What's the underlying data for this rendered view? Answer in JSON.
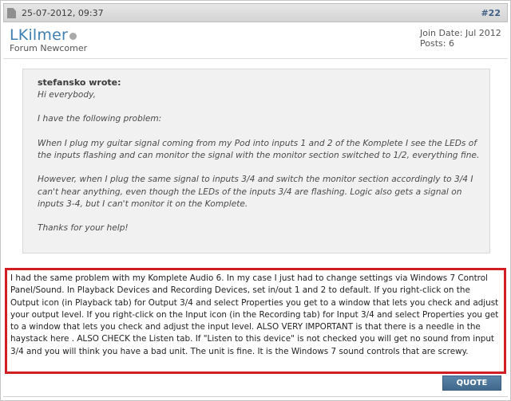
{
  "post": {
    "date": "25-07-2012, 09:37",
    "number": "#22"
  },
  "user": {
    "name": "LKilmer",
    "title": "Forum Newcomer",
    "join_date": "Join Date: Jul 2012",
    "posts": "Posts: 6",
    "status_color": "#a9a9a9"
  },
  "quote": {
    "author": "stefansko wrote:",
    "paragraphs": [
      "Hi everybody,",
      "I have the following problem:",
      "When I plug my guitar signal coming from my Pod into inputs 1 and 2 of the Komplete I see the LEDs of the inputs flashing and can monitor the signal with the monitor section switched to 1/2, everything fine.",
      "However, when I plug the same signal to inputs 3/4 and switch the monitor section accordingly to 3/4 I can't hear anything, even though the LEDs of the inputs 3/4 are flashing. Logic also gets a signal on inputs 3-4, but I can't monitor it on the Komplete.",
      "Thanks for your help!"
    ]
  },
  "reply": {
    "text": "I had the same problem with my Komplete Audio 6. In my case I just had to change settings via Windows 7 Control Panel/Sound. In Playback Devices and Recording Devices, set in/out 1 and 2 to default. If you right-click on the Output icon (in Playback tab) for Output 3/4 and select Properties you get to a window that lets you check and adjust your output level. If you right-click on the Input icon (in the Recording tab) for Input 3/4 and select Properties you get to a window that lets you check and adjust the input level. ALSO VERY IMPORTANT is that there is a needle in the haystack here . ALSO CHECK the Listen tab. If \"Listen to this device\" is not checked you will get no sound from input 3/4 and you will think you have a bad unit. The unit is fine. It is the Windows 7 sound controls that are screwy.",
    "highlight_color": "#d01e24"
  },
  "actions": {
    "quote_label": "QUOTE"
  },
  "icons": {
    "post_icon": "document-icon",
    "status_icon": "offline-status-icon"
  }
}
